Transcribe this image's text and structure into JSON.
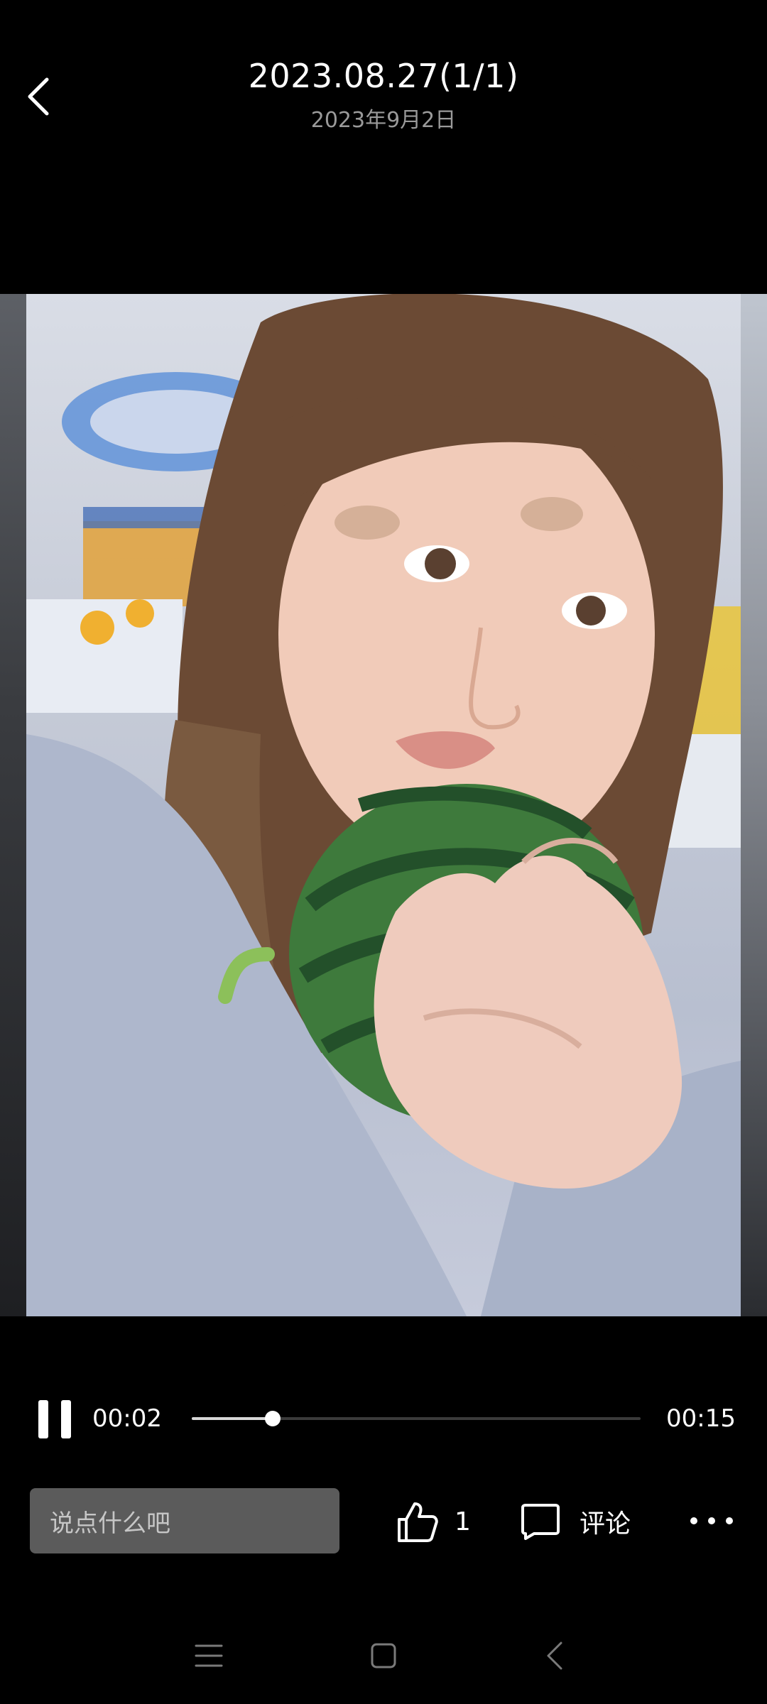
{
  "header": {
    "title": "2023.08.27(1/1)",
    "subtitle": "2023年9月2日",
    "back_icon": "chevron-left-icon"
  },
  "video": {
    "content": "selfie-photo-video",
    "current_time": "00:02",
    "total_time": "00:15",
    "progress": 0.18,
    "pause_icon": "pause-icon"
  },
  "actions": {
    "comment_placeholder": "说点什么吧",
    "like_icon": "thumbs-up-icon",
    "like_count": "1",
    "comment_icon": "comment-bubble-icon",
    "comment_label": "评论",
    "more_icon": "more-dots-icon"
  },
  "system_nav": {
    "menu_icon": "menu-icon",
    "home_icon": "home-square-icon",
    "back_icon": "back-chevron-icon"
  }
}
